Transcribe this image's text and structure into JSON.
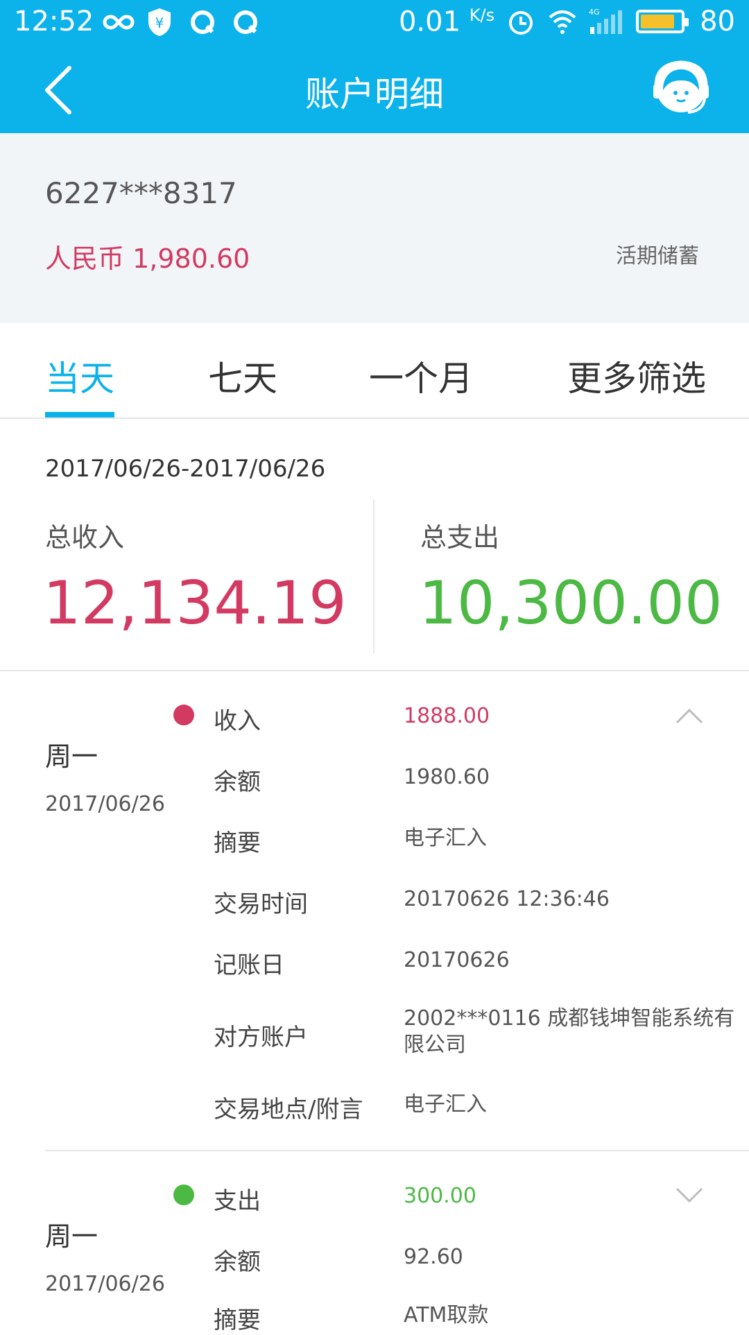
{
  "status_bar": {
    "time": "12:52",
    "net_speed": "0.01",
    "net_unit": "K/s",
    "battery": "80",
    "icons": [
      "infinity-icon",
      "shield-yen-icon",
      "q-icon",
      "q-icon",
      "alarm-icon",
      "wifi-icon",
      "signal-4g-icon",
      "battery-icon"
    ]
  },
  "header": {
    "title": "账户明细",
    "back_icon": "back-arrow-icon",
    "service_icon": "customer-service-icon"
  },
  "account": {
    "number": "6227***8317",
    "balance": "人民币 1,980.60",
    "type": "活期储蓄"
  },
  "tabs": [
    {
      "label": "当天",
      "active": true
    },
    {
      "label": "七天",
      "active": false
    },
    {
      "label": "一个月",
      "active": false
    },
    {
      "label": "更多筛选",
      "active": false
    }
  ],
  "summary": {
    "range": "2017/06/26-2017/06/26",
    "income_label": "总收入",
    "income_value": "12,134.19",
    "expense_label": "总支出",
    "expense_value": "10,300.00"
  },
  "transactions": [
    {
      "weekday": "周一",
      "date": "2017/06/26",
      "kind": "收入",
      "amount": "1888.00",
      "expanded": true,
      "rows": [
        {
          "label": "余额",
          "value": "1980.60"
        },
        {
          "label": "摘要",
          "value": "电子汇入"
        },
        {
          "label": "交易时间",
          "value": "20170626 12:36:46"
        },
        {
          "label": "记账日",
          "value": "20170626"
        },
        {
          "label": "对方账户",
          "value": "2002***0116 成都钱坤智能系统有限公司"
        },
        {
          "label": "交易地点/附言",
          "value": "电子汇入"
        }
      ]
    },
    {
      "weekday": "周一",
      "date": "2017/06/26",
      "kind": "支出",
      "amount": "300.00",
      "expanded": false,
      "rows": [
        {
          "label": "余额",
          "value": "92.60"
        },
        {
          "label": "摘要",
          "value": "ATM取款"
        }
      ]
    }
  ],
  "colors": {
    "brand": "#0cb2ea",
    "income": "#d23a62",
    "expense": "#4cb944",
    "card_bg": "#f2f5f8"
  }
}
